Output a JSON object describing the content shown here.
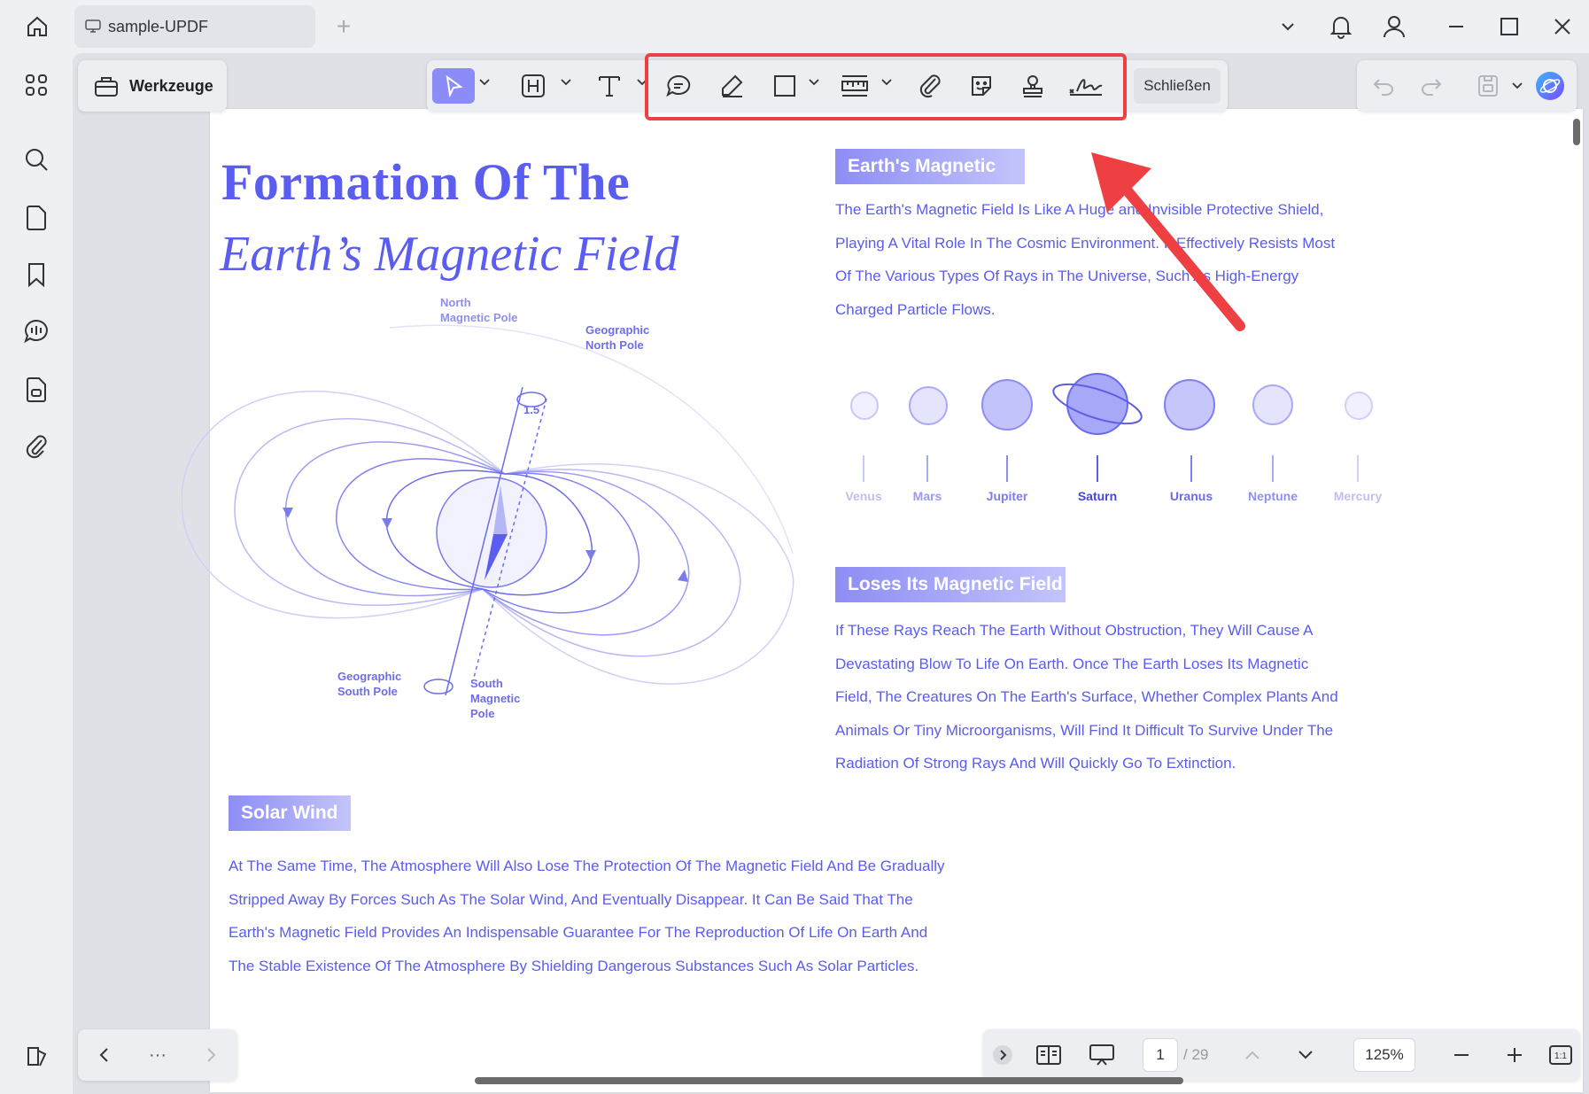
{
  "titlebar": {
    "tab_title": "sample-UPDF",
    "plus": "+"
  },
  "tools": {
    "werkzeuge_label": "Werkzeuge",
    "close_label": "Schließen"
  },
  "page": {
    "title_line1": "Formation Of The",
    "title_line2": "Earth’s Magnetic Field",
    "section1": {
      "heading": "Earth's Magnetic",
      "lines": [
        "The Earth's Magnetic Field Is Like A Huge and Invisible Protective Shield,",
        "Playing A Vital Role In The Cosmic Environment. It Effectively Resists Most",
        "Of The Various Types Of Rays in The Universe, Such As High-Energy",
        "Charged Particle Flows."
      ]
    },
    "section2": {
      "heading": "Loses Its Magnetic Field",
      "lines": [
        "If These Rays Reach The Earth Without Obstruction, They Will Cause A",
        "Devastating Blow To Life On Earth. Once The Earth Loses Its Magnetic",
        "Field, The Creatures On The Earth's Surface, Whether Complex Plants And",
        "Animals Or Tiny Microorganisms, Will Find It Difficult To Survive Under The",
        "Radiation Of Strong Rays And Will Quickly Go To Extinction."
      ]
    },
    "section3": {
      "heading": "Solar Wind",
      "lines": [
        "At The Same Time, The Atmosphere Will Also Lose The Protection Of The Magnetic Field And Be Gradually",
        "Stripped Away By Forces Such As The Solar Wind, And Eventually Disappear. It Can Be Said That The",
        "Earth's Magnetic Field Provides An Indispensable Guarantee For The Reproduction Of Life On Earth And",
        "The Stable Existence Of The Atmosphere By Shielding Dangerous Substances Such As Solar Particles."
      ]
    },
    "diagram": {
      "north_magnetic": "North",
      "north_magnetic2": "Magnetic Pole",
      "geo_north": "Geographic",
      "geo_north2": "North Pole",
      "tilt": "1.5",
      "geo_south": "Geographic",
      "geo_south2": "South Pole",
      "south_magnetic": "South",
      "south_magnetic2": "Magnetic",
      "south_magnetic3": "Pole"
    },
    "planets": [
      "Venus",
      "Mars",
      "Jupiter",
      "Saturn",
      "Uranus",
      "Neptune",
      "Mercury"
    ]
  },
  "nav": {
    "more": "···",
    "current_page": "1",
    "total_pages": "/ 29",
    "zoom": "125%"
  },
  "colors": {
    "accent": "#5b5cf0",
    "tool_active": "#8b8cf8",
    "highlight_red": "#ee3f43"
  }
}
